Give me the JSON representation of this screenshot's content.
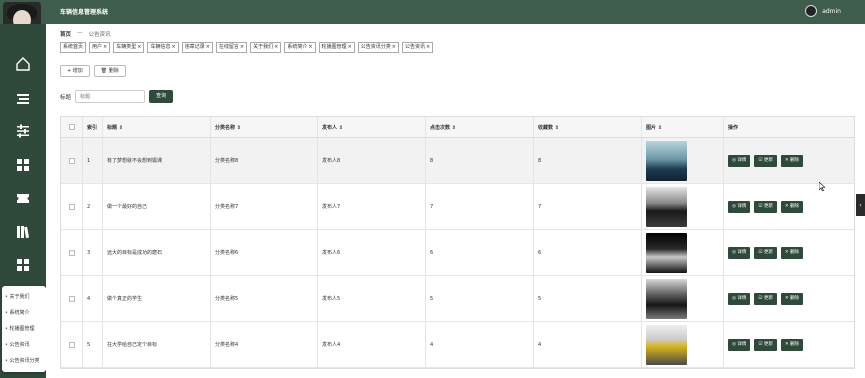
{
  "header": {
    "title": "车辆信息管理系统",
    "user": "admin"
  },
  "breadcrumb": {
    "home": "首页",
    "sep": "—",
    "current": "公告资讯"
  },
  "tags": [
    "系统首页",
    "用户",
    "车辆类型",
    "车辆信息",
    "违章记录",
    "在线留言",
    "关于我们",
    "系统简介",
    "轮播图管理",
    "公告资讯分类",
    "公告资讯"
  ],
  "buttons": {
    "add": "+ 增加",
    "delete": "删除"
  },
  "search": {
    "label": "标题",
    "placeholder": "标题",
    "button": "查询"
  },
  "table": {
    "columns": [
      "",
      "索引",
      "标题 ⇕",
      "分类名称 ⇕",
      "发布人 ⇕",
      "点击次数 ⇕",
      "收藏数 ⇕",
      "图片 ⇕",
      "操作"
    ],
    "rows": [
      {
        "index": "1",
        "title": "有了梦想就不会想到辍课",
        "category": "分类名称8",
        "publisher": "发布人8",
        "clicks": "8",
        "favorites": "8",
        "image": "car-blue"
      },
      {
        "index": "2",
        "title": "做一个最好的自己",
        "category": "分类名称7",
        "publisher": "发布人7",
        "clicks": "7",
        "favorites": "7",
        "image": "car-black"
      },
      {
        "index": "3",
        "title": "远大的目标是成功的磨石",
        "category": "分类名称6",
        "publisher": "发布人6",
        "clicks": "6",
        "favorites": "6",
        "image": "car-sport"
      },
      {
        "index": "4",
        "title": "做个真正的学生",
        "category": "分类名称5",
        "publisher": "发布人5",
        "clicks": "5",
        "favorites": "5",
        "image": "car-dark"
      },
      {
        "index": "5",
        "title": "在大学给自己定个目标",
        "category": "分类名称4",
        "publisher": "发布人4",
        "clicks": "4",
        "favorites": "4",
        "image": "car-yellow"
      }
    ],
    "actions": {
      "detail": "◎ 详情",
      "edit": "☑ 更新",
      "delete": "✕ 删除"
    }
  },
  "submenu": [
    "关于我们",
    "系统简介",
    "轮播图管理",
    "公告资讯",
    "公告资讯分类"
  ],
  "colors": {
    "primary": "#2f4a3b",
    "topbar": "#3f5d4c"
  }
}
